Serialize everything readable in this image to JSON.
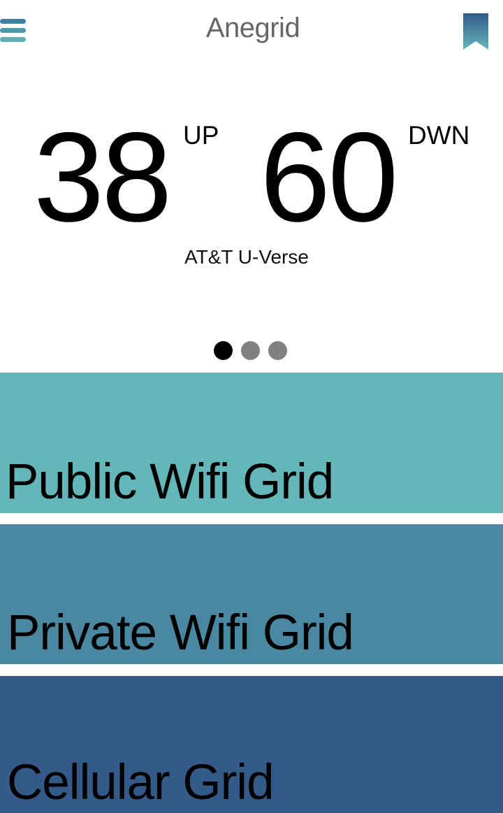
{
  "header": {
    "title": "Anegrid",
    "menu_icon": "hamburger-menu-icon",
    "bookmark_icon": "bookmark-icon"
  },
  "speed": {
    "up_value": "38",
    "up_unit": "UP",
    "down_value": "60",
    "down_unit": "DWN",
    "provider": "AT&T U-Verse"
  },
  "pager": {
    "count": 3,
    "active_index": 0
  },
  "grids": [
    {
      "label": "Public Wifi Grid",
      "color": "#63b7b9"
    },
    {
      "label": "Private Wifi Grid",
      "color": "#4a88a2"
    },
    {
      "label": "Cellular Grid",
      "color": "#345a8a"
    }
  ],
  "colors": {
    "bookmark_top": "#345a8a",
    "bookmark_bottom": "#63b7b9",
    "dot_active": "#000000",
    "dot_inactive": "#808080"
  }
}
